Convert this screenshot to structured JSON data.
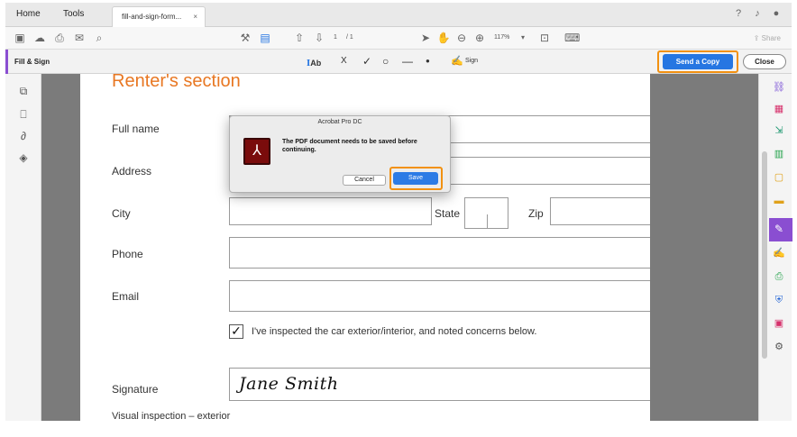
{
  "tabs": {
    "home": "Home",
    "tools": "Tools",
    "document": "fill-and-sign-form...",
    "close_glyph": "×"
  },
  "toolbar": {
    "page_current": "1",
    "page_total": "/ 1",
    "zoom": "117%",
    "share_label": "Share"
  },
  "fillsign": {
    "title": "Fill & Sign",
    "text_tool": "Ab",
    "cross_tool": "X",
    "check_tool": "✓",
    "sign_label": "Sign",
    "send_copy": "Send a Copy",
    "close": "Close"
  },
  "form": {
    "section_title": "Renter's section",
    "labels": {
      "full_name": "Full name",
      "address": "Address",
      "city": "City",
      "state": "State",
      "zip": "Zip",
      "phone": "Phone",
      "email": "Email",
      "signature": "Signature"
    },
    "checkbox_checked": "✓",
    "checkbox_label": "I've inspected the car exterior/interior, and noted concerns below.",
    "signature_value": "Jane Smith",
    "cutoff_text": "Visual inspection – exterior"
  },
  "dialog": {
    "title": "Acrobat Pro DC",
    "message": "The PDF document needs to be saved before continuing.",
    "cancel": "Cancel",
    "save": "Save"
  },
  "colors": {
    "accent_purple": "#8a4ed1",
    "highlight_orange": "#f29111",
    "button_blue": "#2676e2",
    "section_orange": "#e87722"
  }
}
